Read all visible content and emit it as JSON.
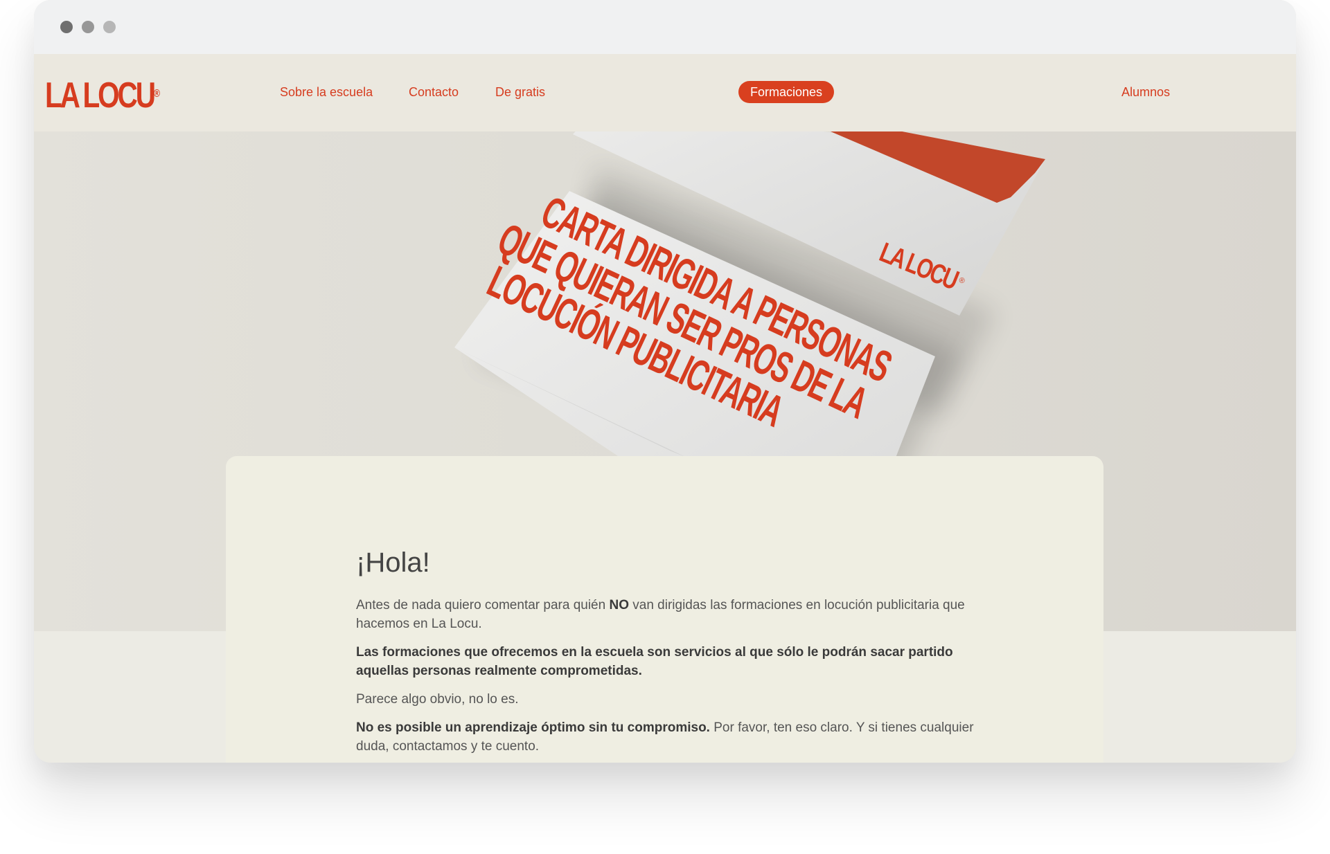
{
  "nav": {
    "logo": "LA LOCU",
    "logo_mark": "®",
    "items": [
      "Sobre la escuela",
      "Contacto",
      "De gratis"
    ],
    "cta": "Formaciones",
    "right": "Alumnos"
  },
  "hero": {
    "envelope_text": [
      "CARTA DIRIGIDA A PERSONAS",
      "QUE QUIERAN SER PROS DE LA",
      "LOCUCIÓN PUBLICITARIA"
    ],
    "envelope_logo": "LA LOCU",
    "envelope_logo_mark": "®"
  },
  "content": {
    "heading": "¡Hola!",
    "p1_before": "Antes de nada quiero comentar para quién ",
    "p1_bold": "NO",
    "p1_after": " van dirigidas las formaciones en locución publicitaria que hacemos en La Locu.",
    "p2_bold": "Las formaciones que ofrecemos en la escuela son servicios al que sólo le podrán sacar partido aquellas personas realmente comprometidas.",
    "p3": "Parece algo obvio, no lo es.",
    "p4_bold": "No es posible un aprendizaje óptimo sin tu compromiso.",
    "p4_after": " Por favor, ten eso claro. Y si tienes cualquier duda, contactamos y te cuento."
  },
  "colors": {
    "accent": "#d63c1f",
    "card_bg": "#efeee2",
    "nav_bg": "#ebe8df"
  }
}
